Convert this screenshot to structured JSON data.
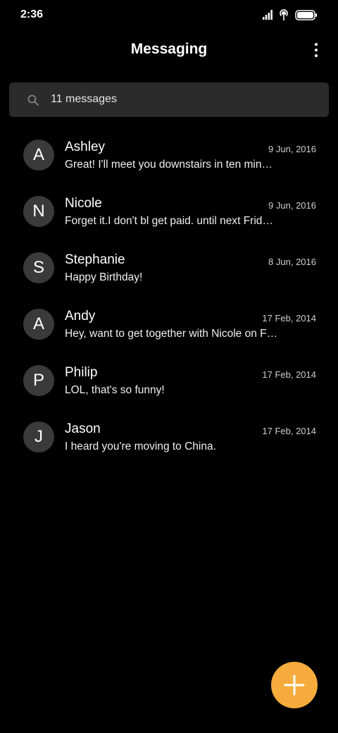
{
  "status_bar": {
    "time": "2:36"
  },
  "header": {
    "title": "Messaging"
  },
  "search": {
    "text": "11 messages"
  },
  "conversations": [
    {
      "initial": "A",
      "name": "Ashley",
      "date": "9 Jun, 2016",
      "preview": "Great! I'll meet you downstairs in ten min…"
    },
    {
      "initial": "N",
      "name": "Nicole",
      "date": "9 Jun, 2016",
      "preview": "Forget it.I don't bl get paid. until next Frid…"
    },
    {
      "initial": "S",
      "name": "Stephanie",
      "date": "8 Jun, 2016",
      "preview": "Happy Birthday!"
    },
    {
      "initial": "A",
      "name": "Andy",
      "date": "17 Feb, 2014",
      "preview": "Hey, want to get together with Nicole on F…"
    },
    {
      "initial": "P",
      "name": "Philip",
      "date": "17 Feb, 2014",
      "preview": "LOL, that's so funny!"
    },
    {
      "initial": "J",
      "name": "Jason",
      "date": "17 Feb, 2014",
      "preview": "I heard you're moving to China."
    }
  ],
  "icons": {
    "signal": "signal-icon",
    "hotspot": "hotspot-icon",
    "battery": "battery-icon",
    "more": "more-vert-icon",
    "search": "search-icon",
    "compose": "plus-icon"
  },
  "colors": {
    "background": "#000000",
    "search_bg": "#2b2b2b",
    "avatar_bg": "#3a3a3a",
    "fab_accent": "#f6ac3c"
  }
}
